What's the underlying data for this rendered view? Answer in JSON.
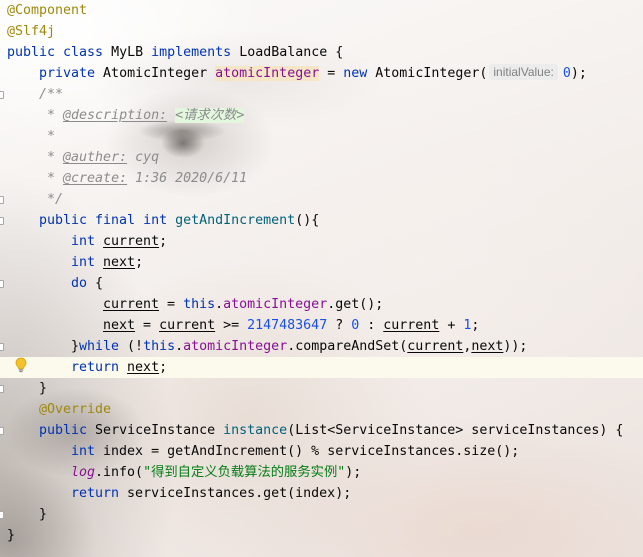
{
  "theme": {
    "text": "#080808",
    "keyword": "#0033B3",
    "annotation": "#9E880D",
    "field": "#871094",
    "method_decl": "#00627A",
    "number": "#1750EB",
    "string": "#067D17",
    "doc_comment": "#8C8C8C",
    "doc_html_bg": "#E3F7DF",
    "warning_bg": "#F5E6C8",
    "current_line_bg": "#FCFAED",
    "inlay_text": "#808080",
    "inlay_bg": "#ECECEC"
  },
  "icons": {
    "intention_action": "lightbulb-icon",
    "fold_marker": "fold-marker-icon"
  },
  "editor": {
    "lines": [
      [
        "@Component"
      ],
      [
        "@Slf4j"
      ],
      [
        "public class",
        " MyLB ",
        "implements",
        " LoadBalance {"
      ],
      [
        "private",
        " AtomicInteger ",
        "atomicInteger",
        " = ",
        "new",
        " AtomicInteger(",
        "initialValue:",
        "0",
        ");"
      ],
      [
        "/**"
      ],
      [
        " * ",
        "@description:",
        " ",
        "<请求次数>"
      ],
      [
        " *"
      ],
      [
        " * ",
        "@auther:",
        " cyq"
      ],
      [
        " * ",
        "@create:",
        " 1:36 2020/6/11"
      ],
      [
        " */"
      ],
      [
        "public final int ",
        "getAndIncrement",
        "(){"
      ],
      [
        "int ",
        "current",
        ";"
      ],
      [
        "int ",
        "next",
        ";"
      ],
      [
        "do",
        " {"
      ],
      [
        "current",
        " = ",
        "this",
        ".",
        "atomicInteger",
        ".get();"
      ],
      [
        "next",
        " = ",
        "current",
        " >= ",
        "2147483647",
        " ? ",
        "0",
        " : ",
        "current",
        " + ",
        "1",
        ";"
      ],
      [
        "}",
        "while",
        " (!",
        "this",
        ".",
        "atomicInteger",
        ".compareAndSet(",
        "current",
        ",",
        "next",
        "));"
      ],
      [
        "return ",
        "next",
        ";"
      ],
      [
        "}"
      ],
      [
        "@Override"
      ],
      [
        "public",
        " ServiceInstance ",
        "instance",
        "(List<ServiceInstance> serviceInstances) {"
      ],
      [
        "int",
        " index = getAndIncrement() % serviceInstances.size();"
      ],
      [
        "log",
        ".info(",
        "\"得到自定义负载算法的服务实例\"",
        ");"
      ],
      [
        "return",
        " serviceInstances.get(index);"
      ],
      [
        "}"
      ],
      [
        "}"
      ]
    ]
  }
}
